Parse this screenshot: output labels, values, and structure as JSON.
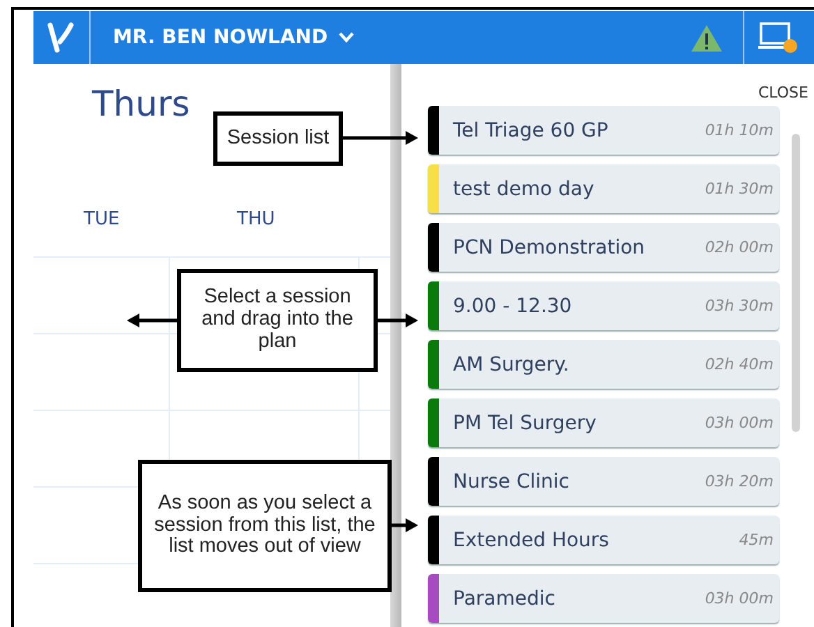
{
  "header": {
    "user_name": "MR. BEN NOWLAND"
  },
  "calendar": {
    "day_title": "Thurs",
    "columns": [
      "TUE",
      "THU"
    ]
  },
  "panel": {
    "close_label": "CLOSE"
  },
  "sessions": [
    {
      "name": "Tel Triage 60 GP",
      "duration": "01h 10m",
      "color": "#000000"
    },
    {
      "name": "test demo day",
      "duration": "01h 30m",
      "color": "#f5e04a"
    },
    {
      "name": "PCN Demonstration",
      "duration": "02h 00m",
      "color": "#000000"
    },
    {
      "name": "9.00 - 12.30",
      "duration": "03h 30m",
      "color": "#0a7a0a"
    },
    {
      "name": "AM Surgery.",
      "duration": "02h 40m",
      "color": "#0a7a0a"
    },
    {
      "name": "PM Tel Surgery",
      "duration": "03h 00m",
      "color": "#0a7a0a"
    },
    {
      "name": "Nurse Clinic",
      "duration": "03h 20m",
      "color": "#000000"
    },
    {
      "name": "Extended Hours",
      "duration": "45m",
      "color": "#000000"
    },
    {
      "name": "Paramedic",
      "duration": "03h 00m",
      "color": "#a64bc0"
    }
  ],
  "annotations": [
    {
      "text": "Session list"
    },
    {
      "text": "Select a session and drag into the plan"
    },
    {
      "text": "As soon as you select a session from this list, the list moves out of view"
    }
  ]
}
